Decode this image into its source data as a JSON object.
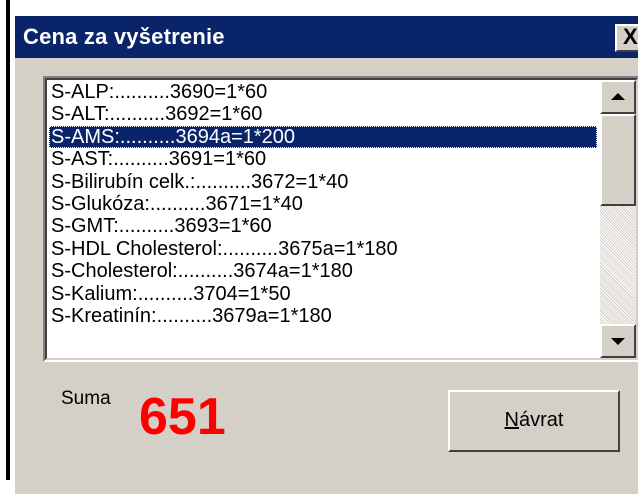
{
  "dialog": {
    "title": "Cena za vyšetrenie",
    "close_glyph": "X"
  },
  "list": {
    "items": [
      "S-ALP:..........3690=1*60",
      "S-ALT:..........3692=1*60",
      "S-AMS:..........3694a=1*200",
      "S-AST:..........3691=1*60",
      "S-Bilirubín celk.:..........3672=1*40",
      "S-Glukóza:..........3671=1*40",
      "S-GMT:..........3693=1*60",
      "S-HDL Cholesterol:..........3675a=1*180",
      "S-Cholesterol:..........3674a=1*180",
      "S-Kalium:..........3704=1*50",
      "S-Kreatinín:..........3679a=1*180"
    ],
    "selected_index": 2
  },
  "summary": {
    "label": "Suma",
    "value": "651"
  },
  "buttons": {
    "return_first": "N",
    "return_rest": "ávrat"
  },
  "colors": {
    "titlebar": "#0a246a",
    "selection": "#0a246a",
    "sum_value": "#ff0000",
    "face": "#d4d0c8"
  }
}
